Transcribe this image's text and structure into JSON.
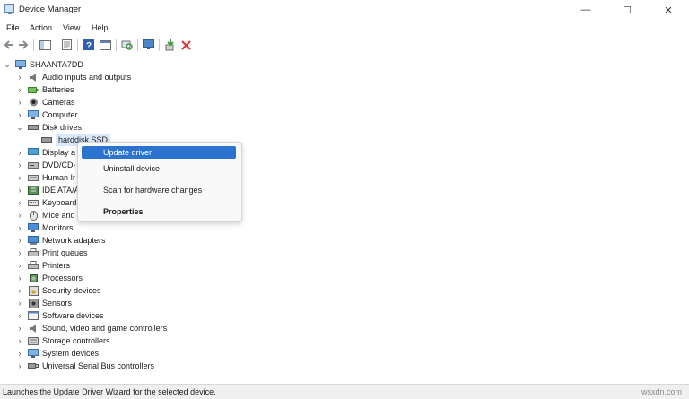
{
  "window": {
    "title": "Device Manager",
    "controls": {
      "minimize": "—",
      "maximize": "☐",
      "close": "✕"
    }
  },
  "menu": [
    {
      "label": "File"
    },
    {
      "label": "Action"
    },
    {
      "label": "View"
    },
    {
      "label": "Help"
    }
  ],
  "toolbar": {
    "buttons": [
      "back-arrow",
      "forward-arrow",
      "show-hide-console-tree",
      "properties",
      "help",
      "action-pane",
      "scan-hardware",
      "display-monitor",
      "update-driver",
      "uninstall-device"
    ]
  },
  "tree": {
    "root": "SHAANTA7DD",
    "items": [
      {
        "label": "Audio inputs and outputs",
        "icon": "speaker-icon",
        "state": "collapsed"
      },
      {
        "label": "Batteries",
        "icon": "battery-icon",
        "state": "collapsed"
      },
      {
        "label": "Cameras",
        "icon": "camera-icon",
        "state": "collapsed"
      },
      {
        "label": "Computer",
        "icon": "computer-icon",
        "state": "collapsed"
      },
      {
        "label": "Disk drives",
        "icon": "disk-drive-icon",
        "state": "expanded"
      },
      {
        "label": "harddisk SSD",
        "icon": "disk-drive-icon",
        "state": "child",
        "selected": true
      },
      {
        "label": "Display a",
        "icon": "display-adapter-icon",
        "state": "collapsed"
      },
      {
        "label": "DVD/CD-",
        "icon": "dvd-icon",
        "state": "collapsed"
      },
      {
        "label": "Human Ir",
        "icon": "hid-icon",
        "state": "collapsed"
      },
      {
        "label": "IDE ATA/A",
        "icon": "ide-controller-icon",
        "state": "collapsed"
      },
      {
        "label": "Keyboard",
        "icon": "keyboard-icon",
        "state": "collapsed"
      },
      {
        "label": "Mice and",
        "icon": "mouse-icon",
        "state": "collapsed"
      },
      {
        "label": "Monitors",
        "icon": "monitor-icon",
        "state": "collapsed"
      },
      {
        "label": "Network adapters",
        "icon": "network-adapter-icon",
        "state": "collapsed"
      },
      {
        "label": "Print queues",
        "icon": "printer-icon",
        "state": "collapsed"
      },
      {
        "label": "Printers",
        "icon": "printer-icon",
        "state": "collapsed"
      },
      {
        "label": "Processors",
        "icon": "processor-icon",
        "state": "collapsed"
      },
      {
        "label": "Security devices",
        "icon": "security-device-icon",
        "state": "collapsed"
      },
      {
        "label": "Sensors",
        "icon": "sensor-icon",
        "state": "collapsed"
      },
      {
        "label": "Software devices",
        "icon": "software-device-icon",
        "state": "collapsed"
      },
      {
        "label": "Sound, video and game controllers",
        "icon": "speaker-icon",
        "state": "collapsed"
      },
      {
        "label": "Storage controllers",
        "icon": "storage-controller-icon",
        "state": "collapsed"
      },
      {
        "label": "System devices",
        "icon": "system-device-icon",
        "state": "collapsed"
      },
      {
        "label": "Universal Serial Bus controllers",
        "icon": "usb-icon",
        "state": "collapsed"
      }
    ]
  },
  "context_menu": {
    "items": [
      {
        "label": "Update driver",
        "active": true
      },
      {
        "label": "Uninstall device"
      },
      {
        "label": "Scan for hardware changes"
      },
      {
        "label": "Properties",
        "bold": true
      }
    ]
  },
  "status": {
    "text": "Launches the Update Driver Wizard for the selected device."
  },
  "watermark": "wsxdn.com",
  "colors": {
    "accent": "#2b73ce",
    "selection": "#d9e8fb",
    "toolbar_green": "#3c9b3c",
    "toolbar_red": "#d23c3c"
  }
}
